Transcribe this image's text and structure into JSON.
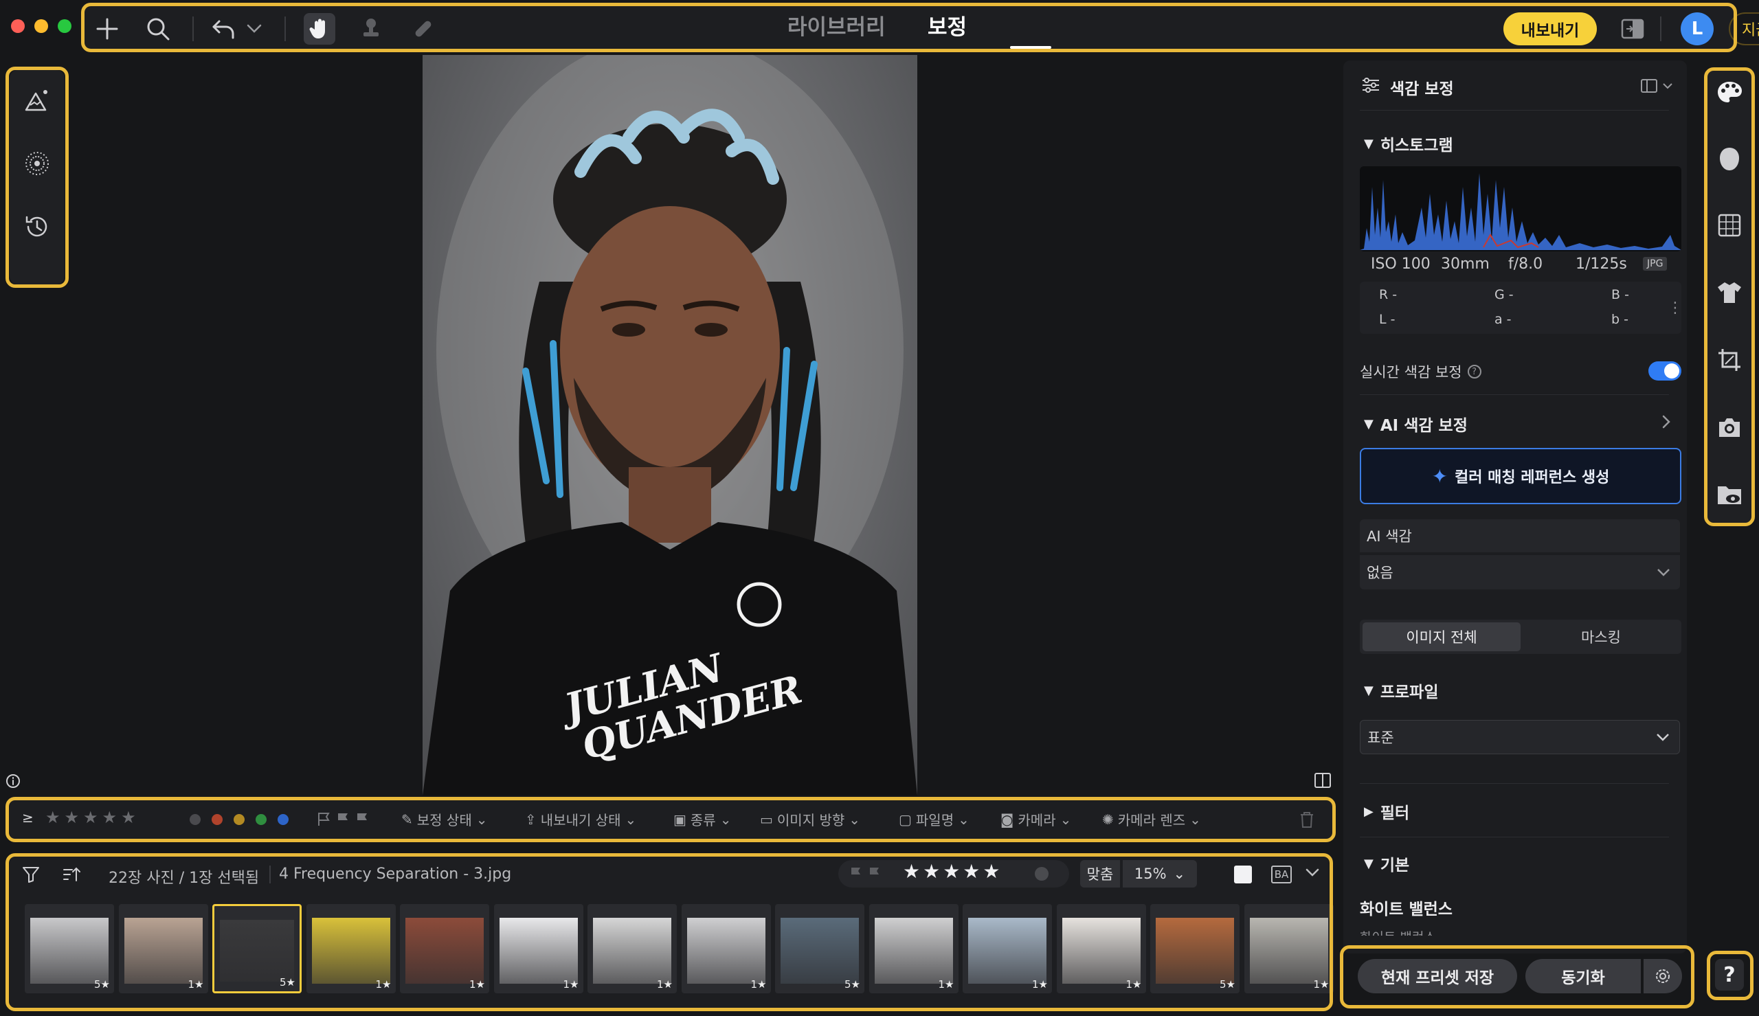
{
  "window": {
    "traffic_light_colors": [
      "#fe5f57",
      "#febc2e",
      "#28c840"
    ]
  },
  "header": {
    "tabs": [
      {
        "label": "라이브러리",
        "active": false
      },
      {
        "label": "보정",
        "active": true
      }
    ],
    "export_label": "내보내기",
    "avatar_letter": "L",
    "buy_label": "지금 구매",
    "icons": [
      "plus-icon",
      "search-icon",
      "undo-icon",
      "chevron-down-icon",
      "hand-icon",
      "stamp-icon",
      "bandage-icon",
      "compare-icon"
    ]
  },
  "left_tools": [
    "adjust-brush-icon",
    "radial-grain-icon",
    "history-icon"
  ],
  "filter_bar": {
    "rating_prefix": "≥",
    "color_dots": [
      "#4a4a4e",
      "#b0432c",
      "#b38a23",
      "#2f8e3f",
      "#2d64c8"
    ],
    "items": [
      "보정 상태",
      "내보내기 상태",
      "종류",
      "이미지 방향",
      "파일명",
      "카메라",
      "카메라 렌즈"
    ]
  },
  "filmstrip": {
    "count_label": "22장 사진 / 1장 선택됨",
    "filename": "4 Frequency Separation - 3.jpg",
    "fit_label": "맞춤",
    "zoom_label": "15%",
    "ba_label": "BA",
    "thumbs": [
      {
        "badge": "5★",
        "selected": false,
        "color": "#c8c8ca"
      },
      {
        "badge": "1★",
        "selected": false,
        "color": "#b9a393"
      },
      {
        "badge": "5★",
        "selected": true,
        "color": "#3a3a3c"
      },
      {
        "badge": "1★",
        "selected": false,
        "color": "#d9c13a"
      },
      {
        "badge": "1★",
        "selected": false,
        "color": "#8c4b3a"
      },
      {
        "badge": "1★",
        "selected": false,
        "color": "#e8e8ea"
      },
      {
        "badge": "1★",
        "selected": false,
        "color": "#d6d6d6"
      },
      {
        "badge": "1★",
        "selected": false,
        "color": "#cfcfd1"
      },
      {
        "badge": "5★",
        "selected": false,
        "color": "#5a6b7a"
      },
      {
        "badge": "1★",
        "selected": false,
        "color": "#cfcfd0"
      },
      {
        "badge": "1★",
        "selected": false,
        "color": "#a9b9c9"
      },
      {
        "badge": "1★",
        "selected": false,
        "color": "#e6e2de"
      },
      {
        "badge": "5★",
        "selected": false,
        "color": "#b56a3e"
      },
      {
        "badge": "1★",
        "selected": false,
        "color": "#b8b6b0"
      }
    ]
  },
  "panel": {
    "title": "색감 보정",
    "histogram": {
      "title": "히스토그램",
      "iso": "ISO 100",
      "focal": "30mm",
      "aperture": "f/8.0",
      "shutter": "1/125s",
      "format": "JPG",
      "r": "R -",
      "g": "G -",
      "b": "B -",
      "l": "L -",
      "a": "a -",
      "b2": "b -"
    },
    "live_label": "실시간 색감 보정",
    "live_on": true,
    "ai": {
      "title": "AI 색감 보정",
      "button_label": "컬러 매칭 레퍼런스 생성",
      "field_label": "AI 색감",
      "field_value": "없음"
    },
    "scope_tabs": [
      {
        "label": "이미지 전체",
        "active": true
      },
      {
        "label": "마스킹",
        "active": false
      }
    ],
    "profile": {
      "title": "프로파일",
      "value": "표준"
    },
    "filter_title": "필터",
    "basic": {
      "title": "기본",
      "wb_label": "화이트 밸런스",
      "wb_sub": "화이트 밸런스"
    }
  },
  "right_icons": [
    "palette-icon",
    "face-icon",
    "checker-icon",
    "shirt-icon",
    "crop-icon",
    "camera-icon",
    "folder-eye-icon"
  ],
  "bottom": {
    "save_preset": "현재 프리셋 저장",
    "sync": "동기화",
    "help": "?"
  }
}
